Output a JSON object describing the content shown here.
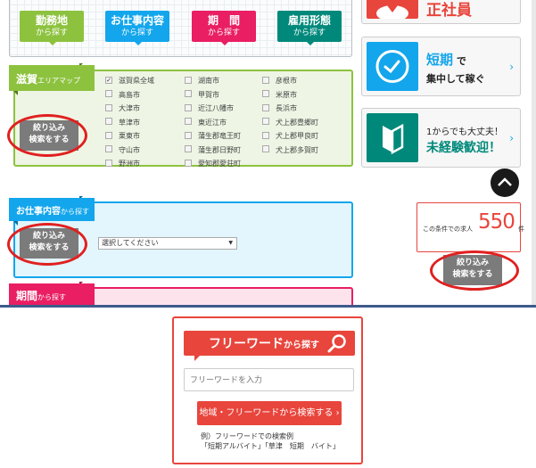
{
  "category_tabs": [
    {
      "title": "勤務地",
      "sub": "から探す",
      "color": "#8dc23f"
    },
    {
      "title": "お仕事内容",
      "sub": "から探す",
      "color": "#13a6ec"
    },
    {
      "title": "期　間",
      "sub": "から探す",
      "color": "#e91e63"
    },
    {
      "title": "雇用形態",
      "sub": "から探す",
      "color": "#00897b"
    }
  ],
  "area_panel": {
    "tab_big": "滋賀",
    "tab_small": "エリアマップ",
    "narrow_button": [
      "絞り込み",
      "検索をする"
    ],
    "checkboxes": [
      {
        "label": "滋賀県全域",
        "checked": true
      },
      {
        "label": "高島市",
        "checked": false
      },
      {
        "label": "大津市",
        "checked": false
      },
      {
        "label": "草津市",
        "checked": false
      },
      {
        "label": "栗東市",
        "checked": false
      },
      {
        "label": "守山市",
        "checked": false
      },
      {
        "label": "野洲市",
        "checked": false
      },
      {
        "label": "湖南市",
        "checked": false
      },
      {
        "label": "甲賀市",
        "checked": false
      },
      {
        "label": "近江八幡市",
        "checked": false
      },
      {
        "label": "東近江市",
        "checked": false
      },
      {
        "label": "蒲生郡竜王町",
        "checked": false
      },
      {
        "label": "蒲生郡日野町",
        "checked": false
      },
      {
        "label": "愛知郡愛荘町",
        "checked": false
      },
      {
        "label": "彦根市",
        "checked": false
      },
      {
        "label": "米原市",
        "checked": false
      },
      {
        "label": "長浜市",
        "checked": false
      },
      {
        "label": "犬上郡豊郷町",
        "checked": false
      },
      {
        "label": "犬上郡甲良町",
        "checked": false
      },
      {
        "label": "犬上郡多賀町",
        "checked": false
      }
    ]
  },
  "job_panel": {
    "tab_big": "お仕事内容",
    "tab_small": "から探す",
    "narrow_button": [
      "絞り込み",
      "検索をする"
    ],
    "select_value": "選択してください",
    "select_arrow": "▼"
  },
  "period_panel": {
    "tab_big": "期間",
    "tab_small": "から探す"
  },
  "promos": [
    {
      "line1": "正社員",
      "line2": "",
      "color": "#e8453c",
      "icon": "person-icon"
    },
    {
      "line1_accent": "短期",
      "line1_rest": " で",
      "line2": "集中して稼ぐ",
      "color": "#13a6ec",
      "icon": "clock-icon"
    },
    {
      "line1": "1からでも大丈夫！",
      "line2": "未経験歓迎！",
      "color": "#00897b",
      "icon": "beginner-mark-icon"
    }
  ],
  "promo_arrow": "›",
  "job_count": {
    "label": "この条件での求人",
    "value": "550",
    "unit": "件"
  },
  "side_narrow_button": [
    "絞り込み",
    "検索をする"
  ],
  "freeword": {
    "title_big": "フリーワード",
    "title_small": "から探す",
    "placeholder": "フリーワードを入力",
    "button": "地域・フリーワードから検索する ›",
    "example_line1": "例）フリーワードでの検索例",
    "example_line2": "「短期アルバイト」「草津　短期　バイト」"
  }
}
